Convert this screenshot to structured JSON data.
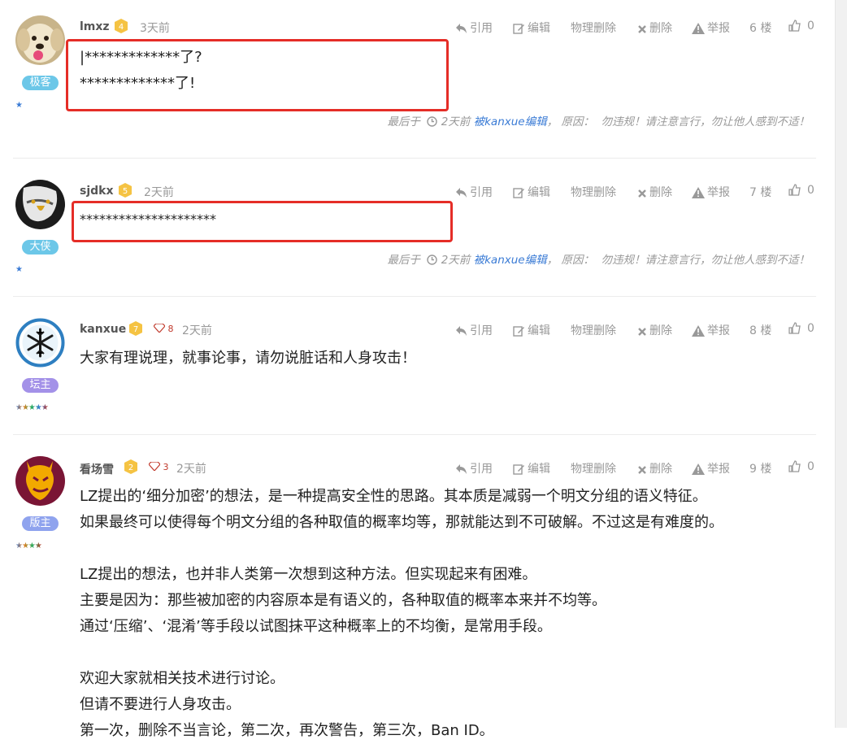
{
  "actions": {
    "quote": "引用",
    "edit": "编辑",
    "hard_delete": "物理删除",
    "delete": "删除",
    "report": "举报",
    "floor_suffix": "楼"
  },
  "edit_note": {
    "prefix": "最后于",
    "time": "2天前",
    "by": "被kanxue编辑",
    "sep": "，",
    "reason_label": "原因：",
    "reason": "勿违规！请注意言行，勿让他人感到不适！"
  },
  "posts": [
    {
      "user": "lmxz",
      "level": "4",
      "time": "3天前",
      "floor": "6",
      "likes": "0",
      "role": "极客",
      "role_color": "#6cc7e8",
      "stars": "★",
      "lines": [
        "|*************了?",
        "*************了!"
      ]
    },
    {
      "user": "sjdkx",
      "level": "5",
      "time": "2天前",
      "floor": "7",
      "likes": "0",
      "role": "大侠",
      "role_color": "#6cc7e8",
      "stars": "★",
      "lines": [
        "*********************"
      ]
    },
    {
      "user": "kanxue",
      "level": "7",
      "gems": "8",
      "time": "2天前",
      "floor": "8",
      "likes": "0",
      "role": "坛主",
      "role_color": "#a391e8",
      "stars": "★★★★★",
      "lines": [
        "大家有理说理，就事论事，请勿说脏话和人身攻击！"
      ]
    },
    {
      "user": "看场雪",
      "level": "2",
      "gems": "3",
      "time": "2天前",
      "floor": "9",
      "likes": "0",
      "role": "版主",
      "role_color": "#8fa3ee",
      "stars": "★★★★",
      "lines": [
        "LZ提出的‘细分加密’的想法，是一种提高安全性的思路。其本质是减弱一个明文分组的语义特征。",
        "如果最终可以使得每个明文分组的各种取值的概率均等，那就能达到不可破解。不过这是有难度的。",
        "",
        "LZ提出的想法，也并非人类第一次想到这种方法。但实现起来有困难。",
        "主要是因为：那些被加密的内容原本是有语义的，各种取值的概率本来并不均等。",
        "通过‘压缩’、‘混淆’等手段以试图抹平这种概率上的不均衡，是常用手段。",
        "",
        "欢迎大家就相关技术进行讨论。",
        "但请不要进行人身攻击。",
        "第一次，删除不当言论，第二次，再次警告，第三次，Ban ID。"
      ]
    }
  ]
}
